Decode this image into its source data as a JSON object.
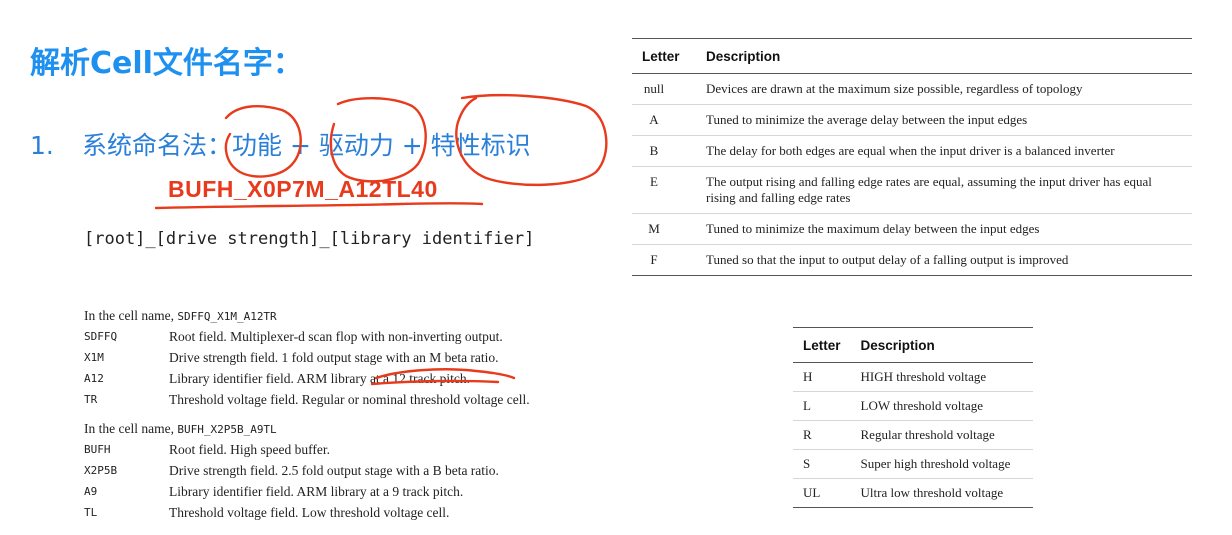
{
  "heading": "解析Cell文件名字：",
  "point": {
    "number": "1.",
    "text": "系统命名法：功能 + 驱动力 + 特性标识"
  },
  "example_name": "BUFH_X0P7M_A12TL40",
  "pattern": "[root]_[drive strength]_[library identifier]",
  "examples": [
    {
      "intro": "In the cell name,",
      "cell": "SDFFQ_X1M_A12TR",
      "fields": [
        {
          "key": "SDFFQ",
          "desc": "Root field. Multiplexer-d scan flop with non-inverting output."
        },
        {
          "key": "X1M",
          "desc": "Drive strength field. 1 fold output stage with an M beta ratio."
        },
        {
          "key": "A12",
          "desc": "Library identifier field. ARM library at a 12 track pitch."
        },
        {
          "key": "TR",
          "desc": "Threshold voltage field. Regular or nominal threshold voltage cell."
        }
      ]
    },
    {
      "intro": "In the cell name,",
      "cell": "BUFH_X2P5B_A9TL",
      "fields": [
        {
          "key": "BUFH",
          "desc": "Root field. High speed buffer."
        },
        {
          "key": "X2P5B",
          "desc": "Drive strength field. 2.5 fold output stage with a B beta ratio."
        },
        {
          "key": "A9",
          "desc": "Library identifier field. ARM library at a 9 track pitch."
        },
        {
          "key": "TL",
          "desc": "Threshold voltage field. Low threshold voltage cell."
        }
      ]
    }
  ],
  "beta_table": {
    "headers": [
      "Letter",
      "Description"
    ],
    "rows": [
      {
        "letter": "null",
        "desc": "Devices are drawn at the maximum size possible, regardless of topology"
      },
      {
        "letter": "A",
        "desc": "Tuned to minimize the average delay between the input edges"
      },
      {
        "letter": "B",
        "desc": "The delay for both edges are equal when the input driver is a balanced inverter"
      },
      {
        "letter": "E",
        "desc": "The output rising and falling edge rates are equal, assuming the input driver has equal rising and falling edge rates"
      },
      {
        "letter": "M",
        "desc": "Tuned to minimize the maximum delay between the input edges"
      },
      {
        "letter": "F",
        "desc": "Tuned so that the input to output delay of a falling output is improved"
      }
    ]
  },
  "vt_table": {
    "headers": [
      "Letter",
      "Description"
    ],
    "rows": [
      {
        "letter": "H",
        "desc": "HIGH threshold voltage"
      },
      {
        "letter": "L",
        "desc": "LOW threshold voltage"
      },
      {
        "letter": "R",
        "desc": "Regular threshold voltage"
      },
      {
        "letter": "S",
        "desc": "Super high threshold voltage"
      },
      {
        "letter": "UL",
        "desc": "Ultra low threshold voltage"
      }
    ]
  },
  "colors": {
    "heading": "#1e90f0",
    "point": "#2a7fd8",
    "ink": "#e83a1c"
  }
}
